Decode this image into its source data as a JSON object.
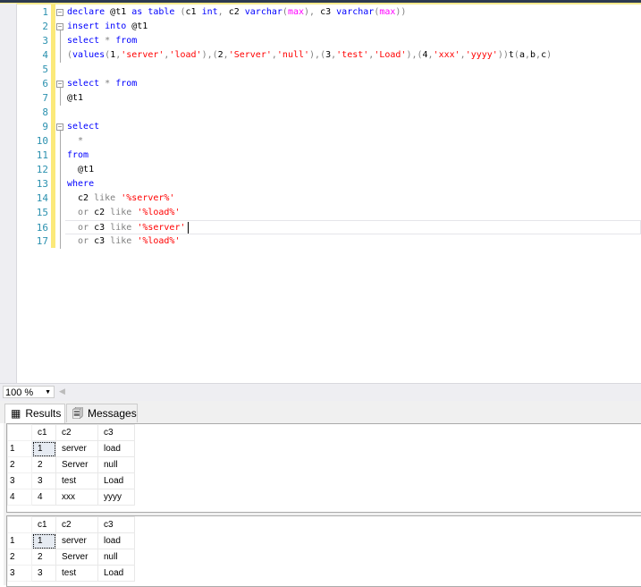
{
  "editor": {
    "lines": [
      {
        "n": "1",
        "tokens": [
          [
            "kw",
            "declare"
          ],
          [
            "id",
            " @t1 "
          ],
          [
            "kw",
            "as"
          ],
          [
            "id",
            " "
          ],
          [
            "kw",
            "table"
          ],
          [
            "id",
            " "
          ],
          [
            "op",
            "("
          ],
          [
            "id",
            "c1 "
          ],
          [
            "kw",
            "int"
          ],
          [
            "op",
            ","
          ],
          [
            "id",
            " c2 "
          ],
          [
            "kw",
            "varchar"
          ],
          [
            "op",
            "("
          ],
          [
            "fn",
            "max"
          ],
          [
            "op",
            "),"
          ],
          [
            "id",
            " c3 "
          ],
          [
            "kw",
            "varchar"
          ],
          [
            "op",
            "("
          ],
          [
            "fn",
            "max"
          ],
          [
            "op",
            "))"
          ]
        ]
      },
      {
        "n": "2",
        "tokens": [
          [
            "kw",
            "insert"
          ],
          [
            "id",
            " "
          ],
          [
            "kw",
            "into"
          ],
          [
            "id",
            " @t1"
          ]
        ]
      },
      {
        "n": "3",
        "tokens": [
          [
            "kw",
            "select"
          ],
          [
            "id",
            " "
          ],
          [
            "op",
            "*"
          ],
          [
            "id",
            " "
          ],
          [
            "kw",
            "from"
          ]
        ]
      },
      {
        "n": "4",
        "tokens": [
          [
            "op",
            "("
          ],
          [
            "kw",
            "values"
          ],
          [
            "op",
            "("
          ],
          [
            "id",
            "1"
          ],
          [
            "op",
            ","
          ],
          [
            "str",
            "'server'"
          ],
          [
            "op",
            ","
          ],
          [
            "str",
            "'load'"
          ],
          [
            "op",
            "),("
          ],
          [
            "id",
            "2"
          ],
          [
            "op",
            ","
          ],
          [
            "str",
            "'Server'"
          ],
          [
            "op",
            ","
          ],
          [
            "str",
            "'null'"
          ],
          [
            "op",
            "),("
          ],
          [
            "id",
            "3"
          ],
          [
            "op",
            ","
          ],
          [
            "str",
            "'test'"
          ],
          [
            "op",
            ","
          ],
          [
            "str",
            "'Load'"
          ],
          [
            "op",
            "),("
          ],
          [
            "id",
            "4"
          ],
          [
            "op",
            ","
          ],
          [
            "str",
            "'xxx'"
          ],
          [
            "op",
            ","
          ],
          [
            "str",
            "'yyyy'"
          ],
          [
            "op",
            "))"
          ],
          [
            "id",
            "t"
          ],
          [
            "op",
            "("
          ],
          [
            "id",
            "a"
          ],
          [
            "op",
            ","
          ],
          [
            "id",
            "b"
          ],
          [
            "op",
            ","
          ],
          [
            "id",
            "c"
          ],
          [
            "op",
            ")"
          ]
        ]
      },
      {
        "n": "5",
        "tokens": []
      },
      {
        "n": "6",
        "tokens": [
          [
            "kw",
            "select"
          ],
          [
            "id",
            " "
          ],
          [
            "op",
            "*"
          ],
          [
            "id",
            " "
          ],
          [
            "kw",
            "from"
          ]
        ]
      },
      {
        "n": "7",
        "tokens": [
          [
            "id",
            "@t1"
          ]
        ]
      },
      {
        "n": "8",
        "tokens": []
      },
      {
        "n": "9",
        "tokens": [
          [
            "kw",
            "select"
          ]
        ]
      },
      {
        "n": "10",
        "tokens": [
          [
            "id",
            "  "
          ],
          [
            "op",
            "*"
          ]
        ]
      },
      {
        "n": "11",
        "tokens": [
          [
            "kw",
            "from"
          ]
        ]
      },
      {
        "n": "12",
        "tokens": [
          [
            "id",
            "  @t1"
          ]
        ]
      },
      {
        "n": "13",
        "tokens": [
          [
            "kw",
            "where"
          ]
        ]
      },
      {
        "n": "14",
        "tokens": [
          [
            "id",
            "  c2 "
          ],
          [
            "op",
            "like"
          ],
          [
            "id",
            " "
          ],
          [
            "str",
            "'%server%'"
          ]
        ]
      },
      {
        "n": "15",
        "tokens": [
          [
            "id",
            "  "
          ],
          [
            "op",
            "or"
          ],
          [
            "id",
            " c2 "
          ],
          [
            "op",
            "like"
          ],
          [
            "id",
            " "
          ],
          [
            "str",
            "'%load%'"
          ]
        ]
      },
      {
        "n": "16",
        "tokens": [
          [
            "id",
            "  "
          ],
          [
            "op",
            "or"
          ],
          [
            "id",
            " c3 "
          ],
          [
            "op",
            "like"
          ],
          [
            "id",
            " "
          ],
          [
            "str",
            "'%server'"
          ]
        ],
        "current": true
      },
      {
        "n": "17",
        "tokens": [
          [
            "id",
            "  "
          ],
          [
            "op",
            "or"
          ],
          [
            "id",
            " c3 "
          ],
          [
            "op",
            "like"
          ],
          [
            "id",
            " "
          ],
          [
            "str",
            "'%load%'"
          ]
        ]
      }
    ]
  },
  "zoom": {
    "value": "100 %"
  },
  "tabs": [
    {
      "label": "Results",
      "icon": "grid-icon"
    },
    {
      "label": "Messages",
      "icon": "messages-icon"
    }
  ],
  "results": [
    {
      "columns": [
        "c1",
        "c2",
        "c3"
      ],
      "rows": [
        [
          "1",
          "1",
          "server",
          "load"
        ],
        [
          "2",
          "2",
          "Server",
          "null"
        ],
        [
          "3",
          "3",
          "test",
          "Load"
        ],
        [
          "4",
          "4",
          "xxx",
          "yyyy"
        ]
      ]
    },
    {
      "columns": [
        "c1",
        "c2",
        "c3"
      ],
      "rows": [
        [
          "1",
          "1",
          "server",
          "load"
        ],
        [
          "2",
          "2",
          "Server",
          "null"
        ],
        [
          "3",
          "3",
          "test",
          "Load"
        ]
      ]
    }
  ],
  "colors": {
    "keyword": "#0000ff",
    "string": "#ff0000",
    "function": "#ff00ff",
    "operator": "#808080",
    "linenumber": "#2b91af"
  }
}
